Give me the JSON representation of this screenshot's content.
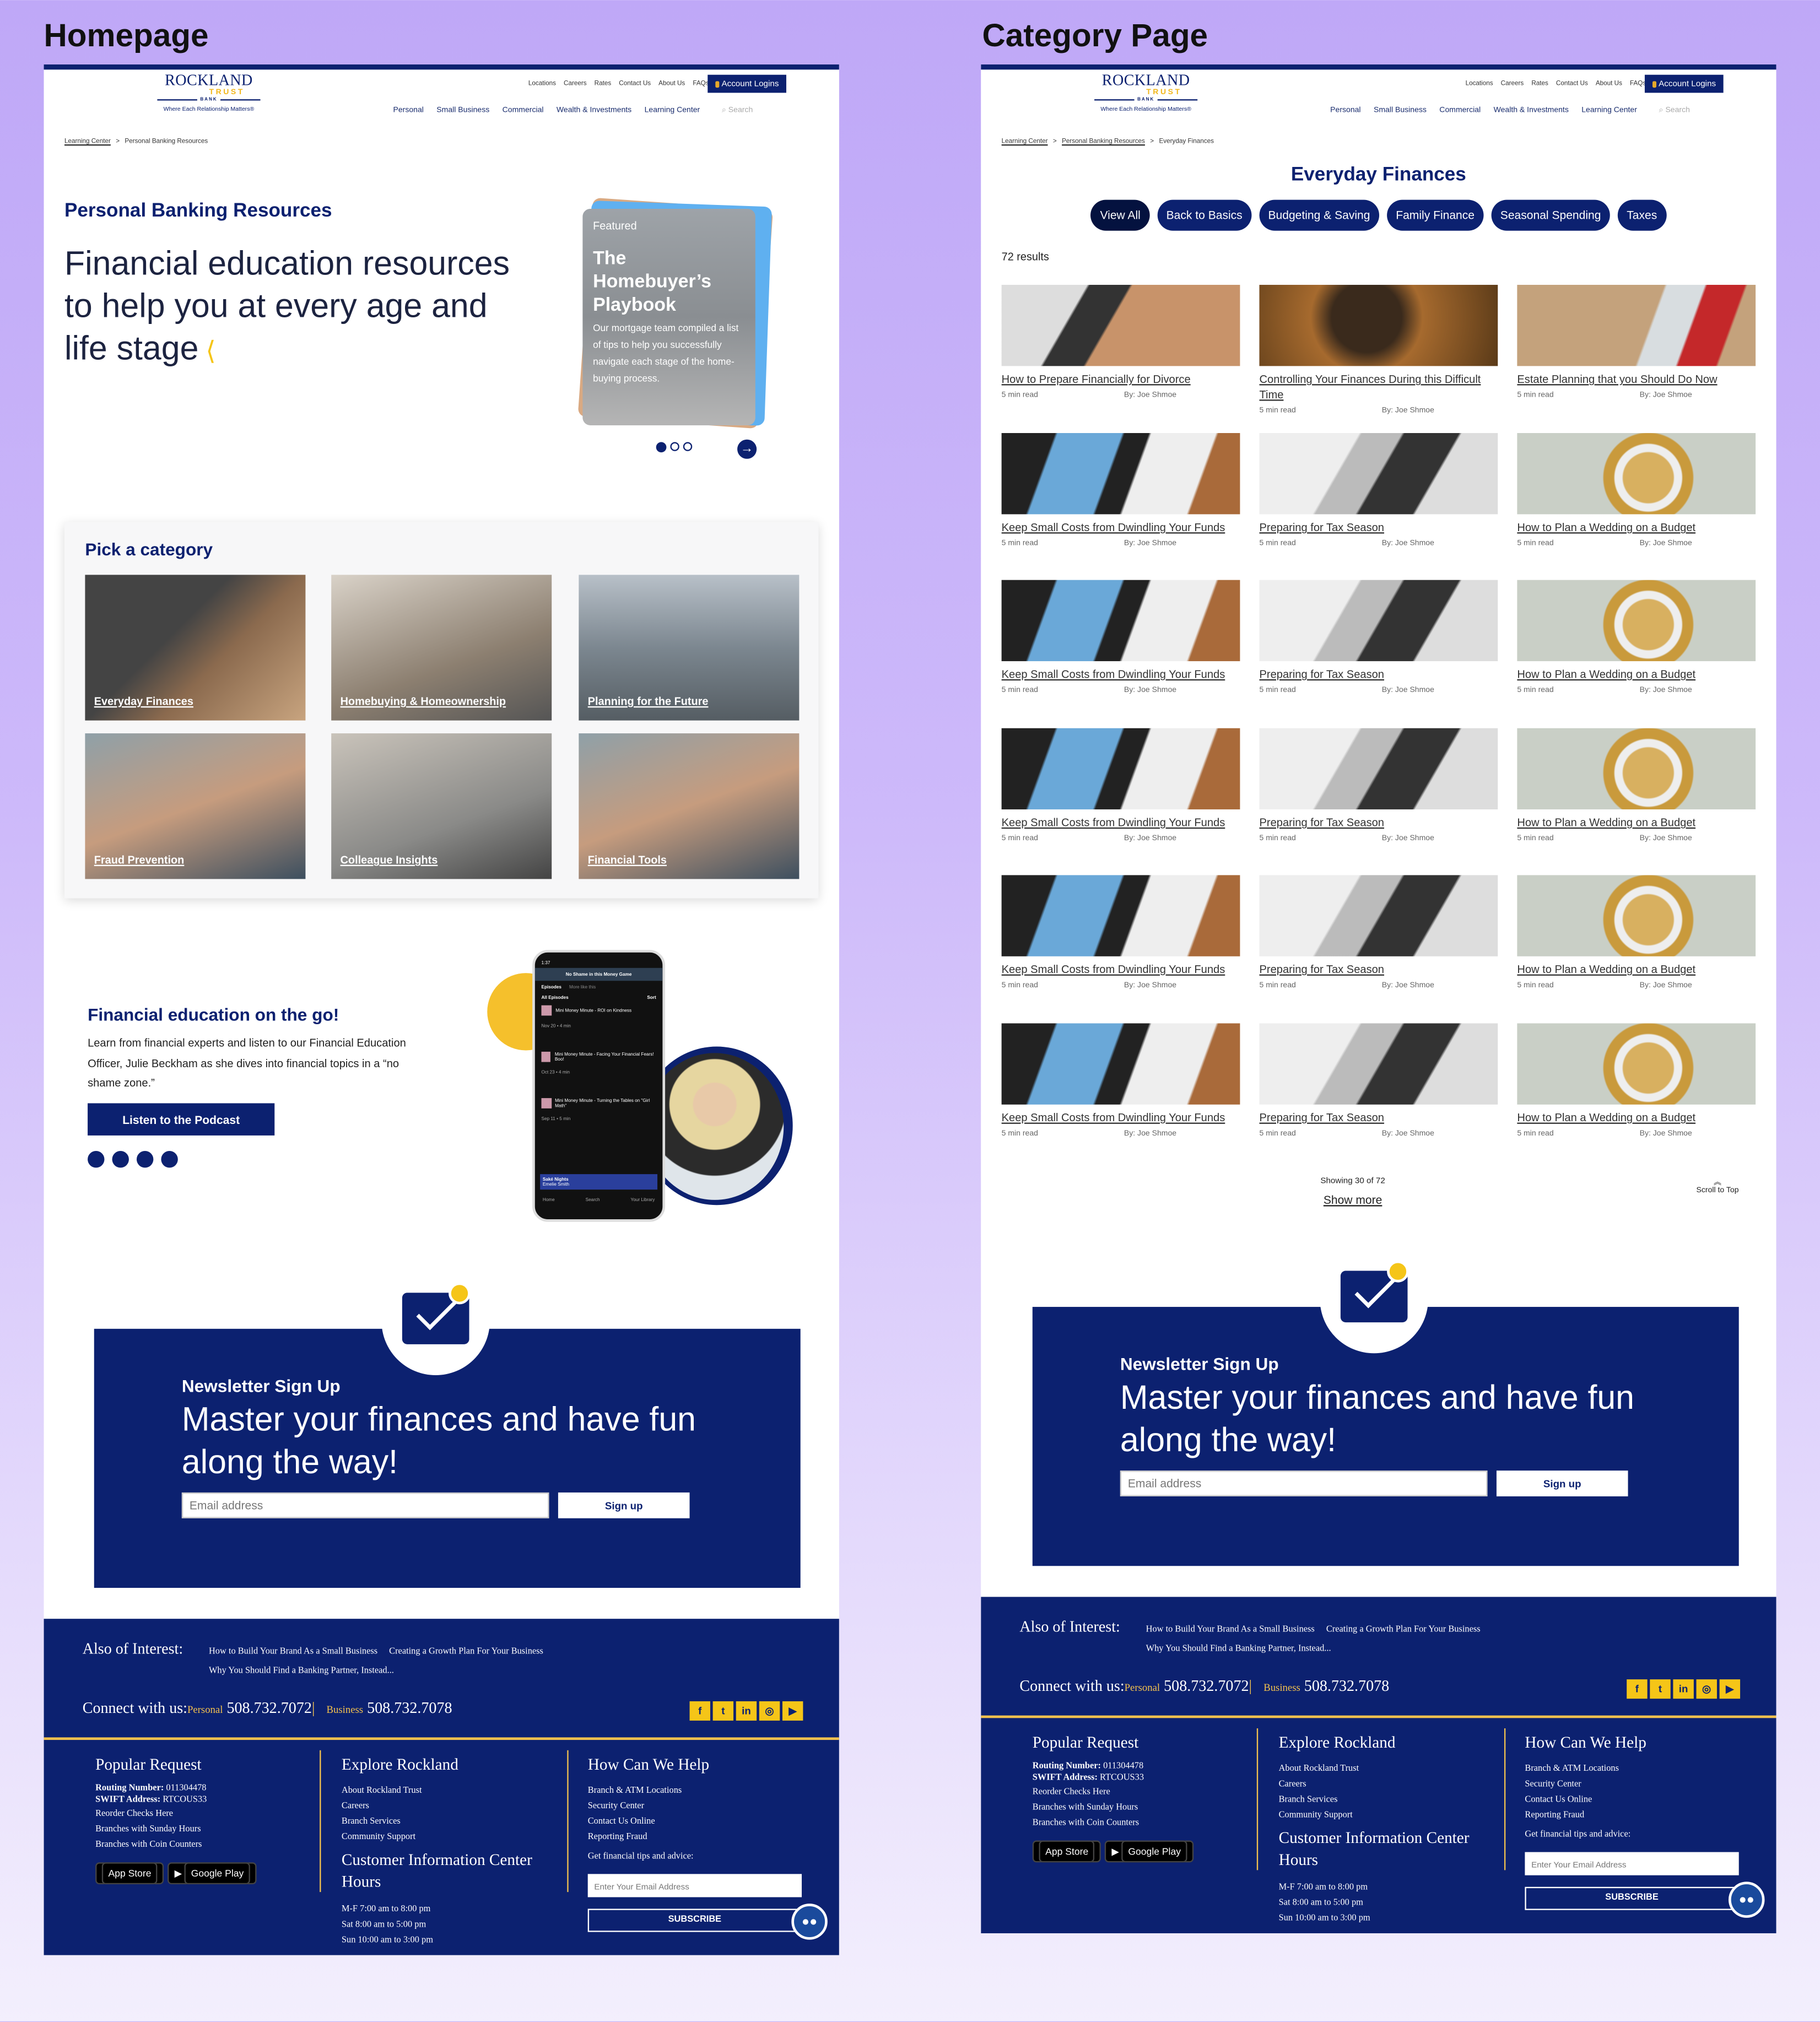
{
  "page_titles": {
    "homepage": "Homepage",
    "category": "Category Page"
  },
  "colors": {
    "navy": "#0c2170",
    "gold": "#f5c518",
    "background": "#c4aef8"
  },
  "header": {
    "logo": {
      "name": "ROCKLAND",
      "trust": "TRUST",
      "bank": "BANK",
      "tagline": "Where Each Relationship Matters®"
    },
    "utility_nav": [
      "Locations",
      "Careers",
      "Rates",
      "Contact Us",
      "About Us",
      "FAQs"
    ],
    "account_logins": "Account Logins",
    "main_nav": [
      "Personal",
      "Small Business",
      "Commercial",
      "Wealth & Investments",
      "Learning Center"
    ],
    "search_placeholder": "Search"
  },
  "home": {
    "breadcrumb": [
      "Learning Center",
      "Personal Banking Resources"
    ],
    "section_title": "Personal Banking Resources",
    "hero_heading": "Financial education resources to help you at every age and life stage",
    "featured": {
      "tag": "Featured",
      "title": "The Homebuyer’s Playbook",
      "text": "Our mortgage team compiled a list of tips to help you successfully navigate each stage of the home-buying process.",
      "slides": 3,
      "active_slide": 1
    },
    "categories_title": "Pick a category",
    "categories": [
      "Everyday Finances",
      "Homebuying & Homeownership",
      "Planning for the Future",
      "Fraud Prevention",
      "Colleague Insights",
      "Financial Tools"
    ],
    "podcast": {
      "title": "Financial education on the go!",
      "text": "Learn from financial experts and listen to our Financial Education Officer, Julie Beckham as she dives into financial topics in a “no shame zone.”",
      "button": "Listen to the Podcast",
      "phone": {
        "time": "1:37",
        "show": "No Shame in this Money Game",
        "tabs": [
          "Episodes",
          "More like this"
        ],
        "list_title": "All Episodes",
        "sort": "Sort",
        "episodes": [
          {
            "title": "Mini Money Minute - ROI on Kindness",
            "date": "Nov 20 • 4 min"
          },
          {
            "title": "Mini Money Minute - Facing Your Financial Fears! Boo!",
            "date": "Oct 23 • 4 min"
          },
          {
            "title": "Mini Money Minute - Turning the Tables on \"Girl Math\"",
            "date": "Sep 11 • 5 min"
          }
        ],
        "now_playing": {
          "title": "Saké Nights",
          "artist": "Emelie Smith"
        },
        "bottom_nav": [
          "Home",
          "Search",
          "Your Library"
        ]
      }
    }
  },
  "category": {
    "breadcrumb": [
      "Learning Center",
      "Personal Banking Resources",
      "Everyday Finances"
    ],
    "title": "Everyday Finances",
    "filters": [
      "View All",
      "Back to Basics",
      "Budgeting & Saving",
      "Family Finance",
      "Seasonal Spending",
      "Taxes"
    ],
    "active_filter": "View All",
    "results": "72 results",
    "articles": [
      {
        "title": "How to Prepare Financially for Divorce",
        "read": "5 min read",
        "author": "By: Joe Shmoe",
        "img": "laptop"
      },
      {
        "title": "Controlling Your Finances During this Difficult Time",
        "read": "5 min read",
        "author": "By: Joe Shmoe",
        "img": "stress"
      },
      {
        "title": "Estate Planning that you Should Do Now",
        "read": "5 min read",
        "author": "By: Joe Shmoe",
        "img": "house"
      },
      {
        "title": "Keep Small Costs from Dwindling Your Funds",
        "read": "5 min read",
        "author": "By: Joe Shmoe",
        "img": "phone"
      },
      {
        "title": "Preparing for Tax Season",
        "read": "5 min read",
        "author": "By: Joe Shmoe",
        "img": "typing"
      },
      {
        "title": "How to Plan a Wedding on a Budget",
        "read": "5 min read",
        "author": "By: Joe Shmoe",
        "img": "rings"
      },
      {
        "title": "Keep Small Costs from Dwindling Your Funds",
        "read": "5 min read",
        "author": "By: Joe Shmoe",
        "img": "phone"
      },
      {
        "title": "Preparing for Tax Season",
        "read": "5 min read",
        "author": "By: Joe Shmoe",
        "img": "typing"
      },
      {
        "title": "How to Plan a Wedding on a Budget",
        "read": "5 min read",
        "author": "By: Joe Shmoe",
        "img": "rings"
      },
      {
        "title": "Keep Small Costs from Dwindling Your Funds",
        "read": "5 min read",
        "author": "By: Joe Shmoe",
        "img": "phone"
      },
      {
        "title": "Preparing for Tax Season",
        "read": "5 min read",
        "author": "By: Joe Shmoe",
        "img": "typing"
      },
      {
        "title": "How to Plan a Wedding on a Budget",
        "read": "5 min read",
        "author": "By: Joe Shmoe",
        "img": "rings"
      },
      {
        "title": "Keep Small Costs from Dwindling Your Funds",
        "read": "5 min read",
        "author": "By: Joe Shmoe",
        "img": "phone"
      },
      {
        "title": "Preparing for Tax Season",
        "read": "5 min read",
        "author": "By: Joe Shmoe",
        "img": "typing"
      },
      {
        "title": "How to Plan a Wedding on a Budget",
        "read": "5 min read",
        "author": "By: Joe Shmoe",
        "img": "rings"
      },
      {
        "title": "Keep Small Costs from Dwindling Your Funds",
        "read": "5 min read",
        "author": "By: Joe Shmoe",
        "img": "phone"
      },
      {
        "title": "Preparing for Tax Season",
        "read": "5 min read",
        "author": "By: Joe Shmoe",
        "img": "typing"
      },
      {
        "title": "How to Plan a Wedding on a Budget",
        "read": "5 min read",
        "author": "By: Joe Shmoe",
        "img": "rings"
      }
    ],
    "showing": "Showing 30 of 72",
    "show_more": "Show more",
    "scroll_top": "Scroll to Top"
  },
  "newsletter": {
    "label": "Newsletter Sign Up",
    "headline": "Master your finances and have fun along the way!",
    "email_placeholder": "Email address",
    "button": "Sign up"
  },
  "footer": {
    "also_label": "Also of Interest:",
    "also_links": [
      "How to Build Your Brand As a Small Business",
      "Creating a Growth Plan For Your Business",
      "Why You Should Find a Banking Partner, Instead..."
    ],
    "connect_label": "Connect with us:",
    "personal_label": "Personal",
    "personal_phone": "508.732.7072",
    "business_label": "Business",
    "business_phone": "508.732.7078",
    "social": [
      "facebook",
      "twitter",
      "linkedin",
      "instagram",
      "youtube"
    ],
    "col1": {
      "title": "Popular Request",
      "routing_label": "Routing Number:",
      "routing": "011304478",
      "swift_label": "SWIFT Address:",
      "swift": "RTCOUS33",
      "links": [
        "Reorder Checks Here",
        "Branches with Sunday Hours",
        "Branches with Coin Counters"
      ],
      "app_store": "App Store",
      "google_play": "Google Play"
    },
    "col2": {
      "title": "Explore Rockland",
      "links": [
        "About Rockland Trust",
        "Careers",
        "Branch Services",
        "Community Support"
      ],
      "hours_title": "Customer Information Center Hours",
      "hours": [
        "M-F 7:00 am to 8:00 pm",
        "Sat 8:00 am to 5:00 pm",
        "Sun 10:00 am to 3:00 pm"
      ]
    },
    "col3": {
      "title": "How Can We Help",
      "links": [
        "Branch & ATM Locations",
        "Security Center",
        "Contact Us Online",
        "Reporting Fraud"
      ],
      "tips": "Get financial tips and advice:",
      "email_placeholder": "Enter Your Email Address",
      "subscribe": "SUBSCRIBE"
    }
  }
}
